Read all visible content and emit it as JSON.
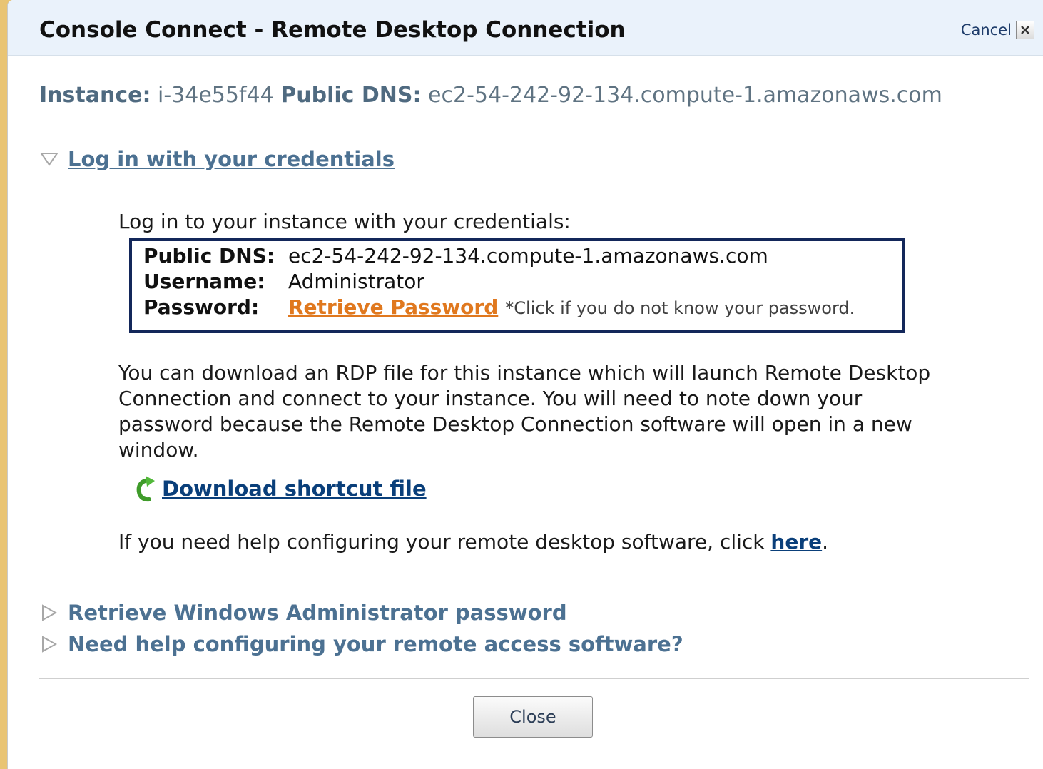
{
  "dialog": {
    "title": "Console Connect - Remote Desktop Connection",
    "cancel_label": "Cancel"
  },
  "instance_info": {
    "instance_label": "Instance:",
    "instance_id": "i-34e55f44",
    "dns_label": "Public DNS:",
    "dns_value": "ec2-54-242-92-134.compute-1.amazonaws.com"
  },
  "sections": {
    "credentials": {
      "label": "Log in with your credentials",
      "expanded": true,
      "intro": "Log in to your instance with your credentials:",
      "fields": {
        "dns_key": "Public DNS:",
        "dns_value": "ec2-54-242-92-134.compute-1.amazonaws.com",
        "username_key": "Username:",
        "username_value": "Administrator",
        "password_key": "Password:",
        "password_link": "Retrieve Password",
        "password_note": "*Click if you do not know your password."
      },
      "description": "You can download an RDP file for this instance which will launch Remote Desktop Connection and connect to your instance. You will need to note down your password because the Remote Desktop Connection software will open in a new window.",
      "download_label": "Download shortcut file",
      "help_prefix": "If you need help configuring your remote desktop software, click ",
      "help_link": "here",
      "help_suffix": "."
    },
    "retrieve_password": {
      "label": "Retrieve Windows Administrator password",
      "expanded": false
    },
    "remote_help": {
      "label": "Need help configuring your remote access software?",
      "expanded": false
    }
  },
  "footer": {
    "close_label": "Close"
  },
  "colors": {
    "page_background": "#e9c474",
    "titlebar": "#eaf2fb",
    "section_link": "#4c7192",
    "retrieve_link": "#e0781e",
    "primary_link": "#0a3f7a",
    "cred_border": "#13275a"
  },
  "icons": {
    "cancel": "close-x-icon",
    "expanded_section": "triangle-down-icon",
    "collapsed_section": "triangle-right-icon",
    "download": "green-refresh-arrow-icon"
  }
}
